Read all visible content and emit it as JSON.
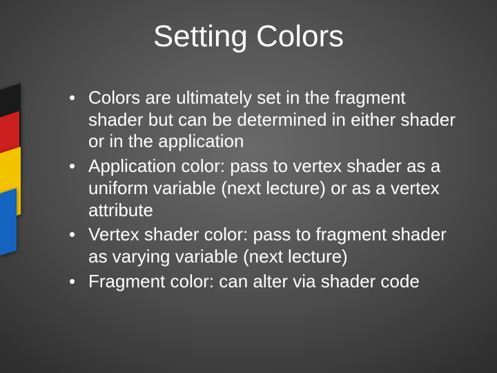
{
  "slide": {
    "title": "Setting Colors",
    "bullets": [
      "Colors are ultimately set in the fragment shader but can be determined in either shader or in the application",
      "Application color: pass to vertex shader as a uniform variable (next lecture) or as a vertex attribute",
      "Vertex shader color: pass to fragment shader as varying variable (next lecture)",
      "Fragment color: can alter via shader code"
    ]
  }
}
